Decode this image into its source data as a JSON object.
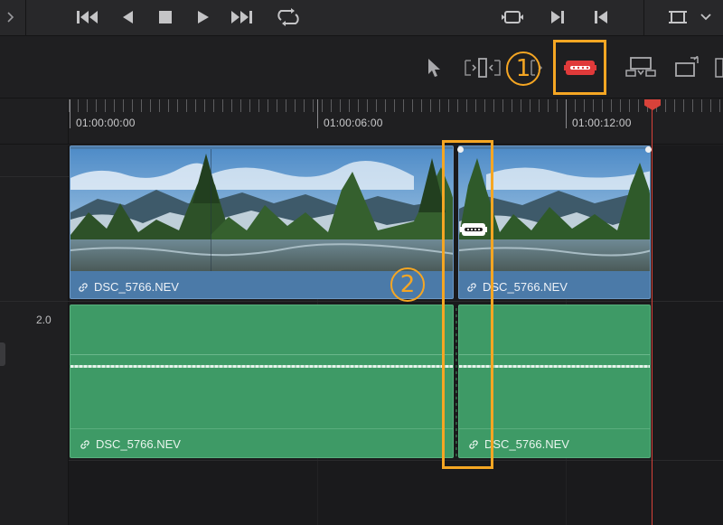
{
  "transport": {
    "buttons": [
      "skip-to-start",
      "step-back",
      "stop",
      "play",
      "skip-to-end",
      "loop",
      "match-frame",
      "mark-in",
      "mark-out",
      "viewer-size"
    ]
  },
  "toolbar": {
    "tools": [
      "selection-mode",
      "trim-edit-mode",
      "dynamic-trim-mode",
      "blade-edit-mode",
      "insert-clip",
      "replace-clip"
    ],
    "active_tool": "blade-edit-mode"
  },
  "callouts": {
    "one": "1",
    "two": "2"
  },
  "ruler": {
    "timecodes": [
      "01:00:00:00",
      "01:00:06:00",
      "01:00:12:00"
    ]
  },
  "tracks": {
    "audio_gain": "2.0",
    "video_clips": [
      {
        "name": "DSC_5766.NEV"
      },
      {
        "name": "DSC_5766.NEV"
      }
    ],
    "audio_clips": [
      {
        "name": "DSC_5766.NEV"
      },
      {
        "name": "DSC_5766.NEV"
      }
    ]
  },
  "colors": {
    "highlight": "#f5a623",
    "video_clip": "#4b7aa8",
    "audio_clip": "#3e9a66",
    "playhead": "#d8423a",
    "blade_active": "#e03a3a"
  },
  "icons": {
    "link": "link-icon",
    "blade": "razor-blade-icon",
    "expand": "chevron-right-icon"
  }
}
